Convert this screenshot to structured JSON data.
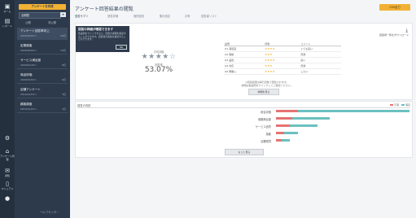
{
  "rail": {
    "items": [
      {
        "icon": "home-icon",
        "glyph": "▣",
        "label": "ホーム"
      },
      {
        "icon": "report-icon",
        "glyph": "▤",
        "label": "レポート"
      },
      {
        "icon": "settings-icon",
        "glyph": "⚙",
        "label": ""
      },
      {
        "icon": "chat-icon",
        "glyph": "⌂",
        "label": "アンケート管理"
      },
      {
        "icon": "mail-icon",
        "glyph": "✉",
        "label": "通知"
      },
      {
        "icon": "doc-icon",
        "glyph": "▯",
        "label": "マニュアル"
      },
      {
        "icon": "user-icon",
        "glyph": "●",
        "label": ""
      }
    ]
  },
  "sidebar": {
    "create_button": "アンケートを作成",
    "select_value": "全期間",
    "select_button": "▾",
    "tabs": [
      "公開",
      "非公開"
    ],
    "items": [
      {
        "title": "アンケート回答率向上",
        "sub": "2020/03/01〜",
        "right": "30日"
      },
      {
        "title": "定期調査",
        "sub": "2020/02/01〜",
        "right": "12日"
      },
      {
        "title": "サービス満足度",
        "sub": "2020/01/15〜",
        "right": "8日"
      },
      {
        "title": "商品評価",
        "sub": "2020/01/01〜",
        "right": "6日"
      },
      {
        "title": "店舗アンケート",
        "sub": "2019/12/01〜",
        "right": "3日"
      },
      {
        "title": "顧客調査",
        "sub": "2019/11/01〜",
        "right": "1日"
      }
    ],
    "footer": "ヘルプセンター"
  },
  "main": {
    "title": "アンケート回答結果の閲覧",
    "export_button": "CSV出力",
    "tabs": [
      "回答サマリ",
      "回答詳細",
      "個別回答",
      "集計設定",
      "共有",
      "回答者リスト"
    ]
  },
  "tooltip": {
    "heading": "回答の詳細が確認できます",
    "body": "各設問をクリックすると、回答の詳細を確認することができます。回答者の属性を確認することもできます。",
    "ok": "OK"
  },
  "summary": {
    "avg_label": "平均評価",
    "stars": "★★★★☆",
    "rate_label": "回答率",
    "rate_value": "53.07%",
    "download_icon": "⤓",
    "table_link": "回答者一覧をダウンロード",
    "table_headers": [
      "設問",
      "評価",
      "コメント"
    ],
    "table_rows": [
      {
        "q": "Q1 満足度",
        "stars": "★★★★",
        "c": "とても良い"
      },
      {
        "q": "Q2 価格",
        "stars": "★★★",
        "c": "普通"
      },
      {
        "q": "Q3 品質",
        "stars": "★★★★",
        "c": "良い"
      },
      {
        "q": "Q4 対応",
        "stars": "★★★",
        "c": "普通"
      },
      {
        "q": "Q5 再購入",
        "stars": "★★★★",
        "c": "したい"
      }
    ],
    "note_line1": "※回答結果は毎日自動で更新されます。",
    "note_line2": "詳細は各設問をクリックしてご確認ください。",
    "details_button": "詳細を見る"
  },
  "chart": {
    "title": "回答の内訳",
    "legend": [
      "不満",
      "満足"
    ],
    "colors": {
      "neg": "#e57373",
      "pos": "#6cc0c0"
    },
    "more_button": "もっと見る"
  },
  "chart_data": {
    "type": "bar",
    "orientation": "horizontal",
    "categories": [
      "総合評価",
      "価格満足度",
      "サービス品質",
      "接客",
      "店舗環境"
    ],
    "series": [
      {
        "name": "不満",
        "values": [
          55,
          40,
          35,
          20,
          15
        ]
      },
      {
        "name": "満足",
        "values": [
          280,
          95,
          70,
          35,
          20
        ]
      }
    ]
  }
}
